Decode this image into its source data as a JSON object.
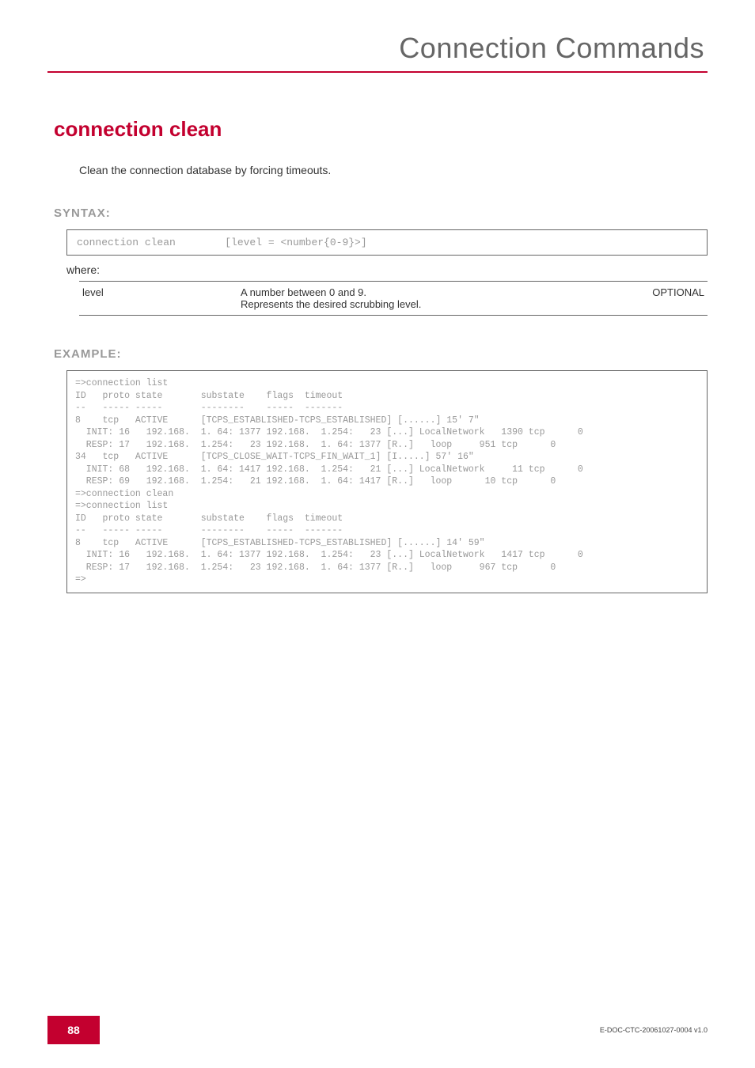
{
  "header": {
    "title": "Connection Commands"
  },
  "command": {
    "name": "connection clean",
    "description": "Clean the connection database by forcing timeouts."
  },
  "syntax": {
    "label": "SYNTAX:",
    "text": "connection clean        [level = <number{0-9}>]",
    "where": "where:",
    "params": [
      {
        "name": "level",
        "desc": "A number between 0 and 9.\nRepresents the desired scrubbing level.",
        "opt": "OPTIONAL"
      }
    ]
  },
  "example": {
    "label": "EXAMPLE:",
    "text": "=>connection list\nID   proto state       substate    flags  timeout\n--   ----- -----       --------    -----  -------\n8    tcp   ACTIVE      [TCPS_ESTABLISHED-TCPS_ESTABLISHED] [......] 15' 7\"\n  INIT: 16   192.168.  1. 64: 1377 192.168.  1.254:   23 [...] LocalNetwork   1390 tcp      0\n  RESP: 17   192.168.  1.254:   23 192.168.  1. 64: 1377 [R..]   loop     951 tcp      0\n34   tcp   ACTIVE      [TCPS_CLOSE_WAIT-TCPS_FIN_WAIT_1] [I.....] 57' 16\"\n  INIT: 68   192.168.  1. 64: 1417 192.168.  1.254:   21 [...] LocalNetwork     11 tcp      0\n  RESP: 69   192.168.  1.254:   21 192.168.  1. 64: 1417 [R..]   loop      10 tcp      0\n=>connection clean\n=>connection list\nID   proto state       substate    flags  timeout\n--   ----- -----       --------    -----  -------\n8    tcp   ACTIVE      [TCPS_ESTABLISHED-TCPS_ESTABLISHED] [......] 14' 59\"\n  INIT: 16   192.168.  1. 64: 1377 192.168.  1.254:   23 [...] LocalNetwork   1417 tcp      0\n  RESP: 17   192.168.  1.254:   23 192.168.  1. 64: 1377 [R..]   loop     967 tcp      0\n=>"
  },
  "footer": {
    "page": "88",
    "doc_id": "E-DOC-CTC-20061027-0004 v1.0"
  }
}
